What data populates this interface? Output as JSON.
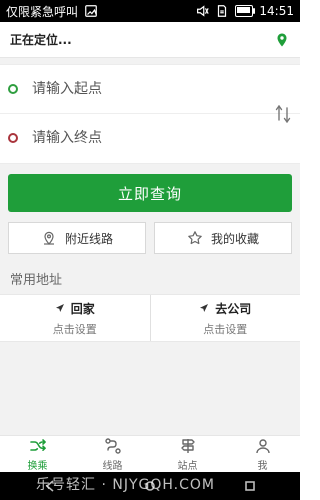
{
  "status": {
    "left_text": "仅限紧急呼叫",
    "time": "14:51"
  },
  "header": {
    "location_text": "正在定位..."
  },
  "route": {
    "start_placeholder": "请输入起点",
    "end_placeholder": "请输入终点"
  },
  "actions": {
    "query_label": "立即查询",
    "nearby_label": "附近线路",
    "favorites_label": "我的收藏"
  },
  "common": {
    "title": "常用地址",
    "home": {
      "label": "回家",
      "sub": "点击设置"
    },
    "company": {
      "label": "去公司",
      "sub": "点击设置"
    }
  },
  "tabs": [
    {
      "label": "换乘"
    },
    {
      "label": "线路"
    },
    {
      "label": "站点"
    },
    {
      "label": "我"
    }
  ],
  "system": {
    "watermark": "乐号轻汇 · NJYGQH.COM"
  },
  "colors": {
    "accent": "#1f9e3a",
    "start_dot": "#2e9e3f",
    "end_dot": "#a9343c"
  }
}
